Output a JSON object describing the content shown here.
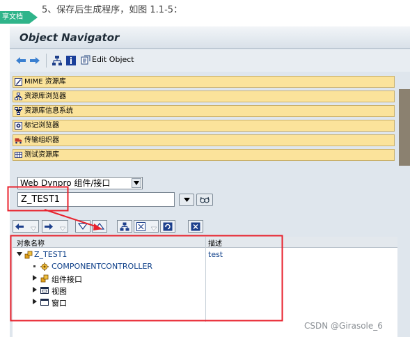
{
  "document": {
    "caption": "5、保存后生成程序，如图 1.1-5：",
    "share_tag": "享文档"
  },
  "window": {
    "title": "Object Navigator"
  },
  "toolbar": {
    "back_icon": "arrow-left-icon",
    "forward_icon": "arrow-right-icon",
    "hierarchy_icon": "hierarchy-icon",
    "info_icon": "info-icon",
    "edit_object_label": "Edit Object"
  },
  "navigation": {
    "items": [
      {
        "label": "MIME 资源库",
        "icon": "mime-icon"
      },
      {
        "label": "资源库浏览器",
        "icon": "repository-browser-icon"
      },
      {
        "label": "资源库信息系统",
        "icon": "repository-info-icon"
      },
      {
        "label": "标记浏览器",
        "icon": "tag-browser-icon"
      },
      {
        "label": "传输组织器",
        "icon": "transport-organizer-icon"
      },
      {
        "label": "测试资源库",
        "icon": "test-repository-icon"
      }
    ]
  },
  "selector": {
    "object_type": "Web Dynpro 组件/接口",
    "object_name": "Z_TEST1"
  },
  "tree": {
    "columns": [
      "对象名称",
      "描述"
    ],
    "rows": [
      {
        "name": "Z_TEST1",
        "description": "test",
        "level": 0,
        "expander": "expanded",
        "icon": "component-icon"
      },
      {
        "name": "COMPONENTCONTROLLER",
        "description": "",
        "level": 1,
        "expander": "leaf",
        "icon": "controller-icon"
      },
      {
        "name": "组件接口",
        "description": "",
        "level": 1,
        "expander": "collapsed",
        "icon": "interface-icon"
      },
      {
        "name": "视图",
        "description": "",
        "level": 1,
        "expander": "collapsed",
        "icon": "view-icon"
      },
      {
        "name": "窗口",
        "description": "",
        "level": 1,
        "expander": "collapsed",
        "icon": "window-icon"
      }
    ]
  },
  "colors": {
    "nav_item_bg": "#fbe39b",
    "highlight": "#e8212c",
    "tree_link": "#0c3e88",
    "share_tag": "#2fb48a"
  },
  "watermark": "CSDN @Girasole_6"
}
